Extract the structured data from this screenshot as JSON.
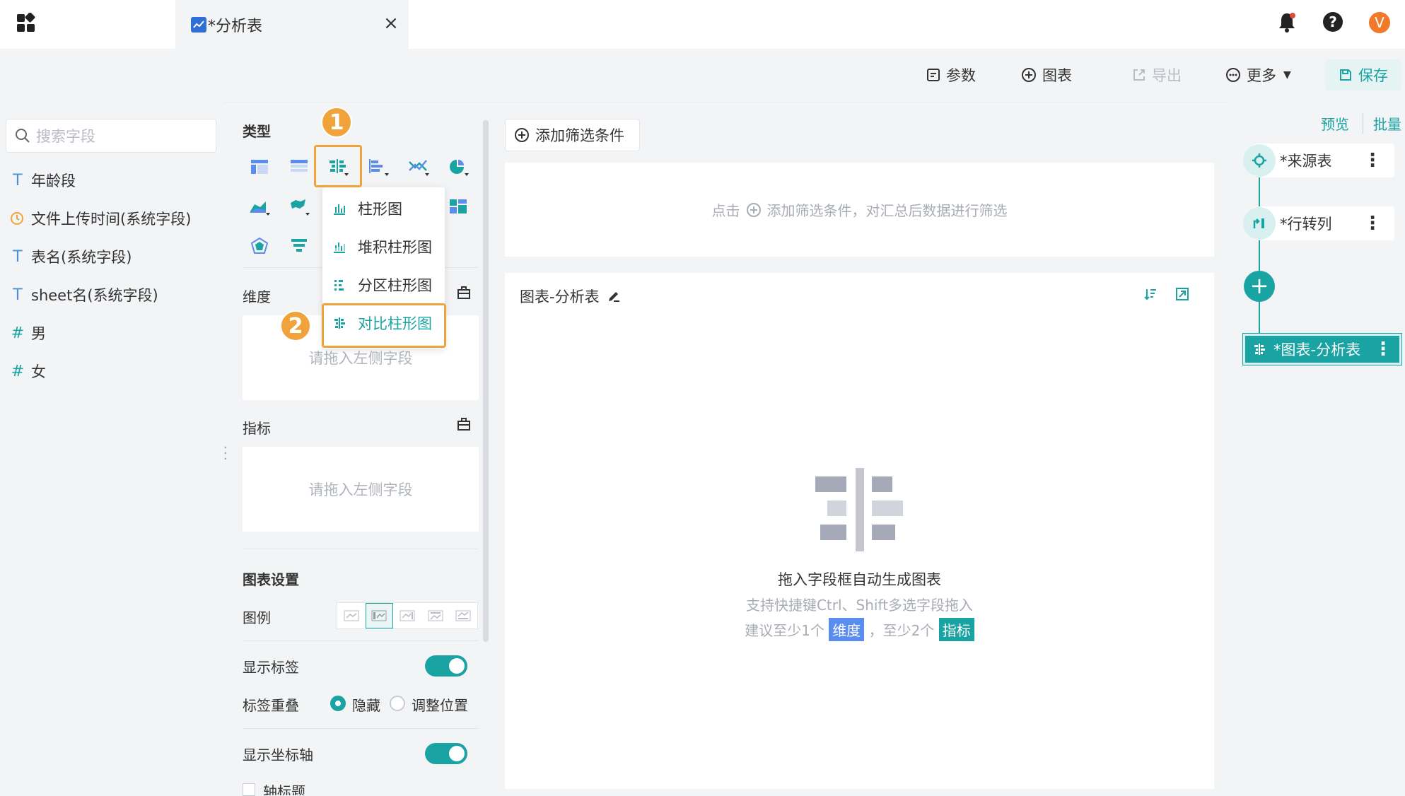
{
  "tabs": [
    {
      "label": "*分析表"
    }
  ],
  "toolbar": {
    "params": "参数",
    "chart": "图表",
    "export": "导出",
    "more": "更多",
    "save": "保存"
  },
  "left": {
    "search_placeholder": "搜索字段",
    "fields": [
      {
        "type": "T",
        "label": "年龄段"
      },
      {
        "type": "clock",
        "label": "文件上传时间(系统字段)"
      },
      {
        "type": "T",
        "label": "表名(系统字段)"
      },
      {
        "type": "T",
        "label": "sheet名(系统字段)"
      },
      {
        "type": "#",
        "label": "男"
      },
      {
        "type": "#",
        "label": "女"
      }
    ]
  },
  "mid": {
    "type_label": "类型",
    "dimension_label": "维度",
    "metric_label": "指标",
    "drop_hint": "请拖入左侧字段",
    "settings_label": "图表设置",
    "legend_label": "图例",
    "show_labels": "显示标签",
    "label_overlap": "标签重叠",
    "overlap_hide": "隐藏",
    "overlap_adjust": "调整位置",
    "show_axis": "显示坐标轴",
    "axis_title_partial": "轴标题"
  },
  "dropdown": {
    "items": [
      "柱形图",
      "堆积柱形图",
      "分区柱形图",
      "对比柱形图"
    ]
  },
  "badges": [
    "1",
    "2"
  ],
  "main": {
    "add_filter": "添加筛选条件",
    "filter_hint_pre": "点击",
    "filter_hint_post": "添加筛选条件，对汇总后数据进行筛选",
    "chart_title": "图表-分析表",
    "empty_title": "拖入字段框自动生成图表",
    "empty_sub": "支持快捷键Ctrl、Shift多选字段拖入",
    "suggest_pre": "建议至少1个",
    "suggest_dim": "维度",
    "suggest_mid": "，至少2个",
    "suggest_metric": "指标"
  },
  "right": {
    "preview": "预览",
    "batch": "批量",
    "nodes": [
      "*来源表",
      "*行转列",
      "*图表-分析表"
    ]
  },
  "user_initial": "V",
  "colors": {
    "accent": "#1aa3a3",
    "highlight": "#f0a33a",
    "dim_chip": "#5b8def",
    "metric_chip": "#1aa3a3"
  }
}
